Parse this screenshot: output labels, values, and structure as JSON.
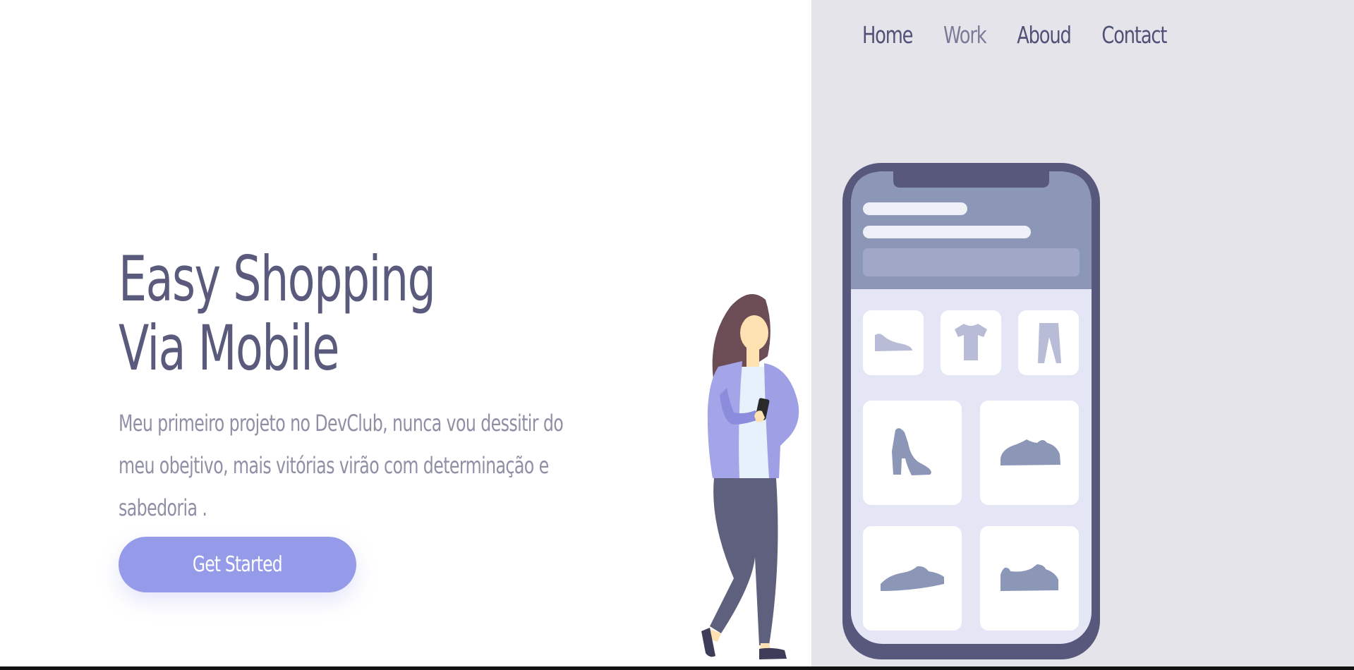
{
  "nav": {
    "items": [
      {
        "label": "Home"
      },
      {
        "label": "Work"
      },
      {
        "label": "Aboud"
      },
      {
        "label": "Contact"
      }
    ]
  },
  "hero": {
    "title_line1": "Easy Shopping",
    "title_line2": "Via Mobile",
    "description": "Meu primeiro projeto no DevClub, nunca vou dessitir do meu obejtivo, mais vitórias virão com determinação e sabedoria .",
    "cta_label": "Get Started"
  },
  "colors": {
    "panel_bg": "#e5e4ea",
    "text_dark": "#5a5b7c",
    "text_muted": "#8f8fa6",
    "accent": "#959be9",
    "phone_frame": "#57587c"
  },
  "illustration": {
    "products": [
      "shoe-icon",
      "tshirt-icon",
      "pants-icon",
      "boot-icon",
      "sneaker-icon",
      "sneaker-icon",
      "sneaker-icon"
    ]
  }
}
